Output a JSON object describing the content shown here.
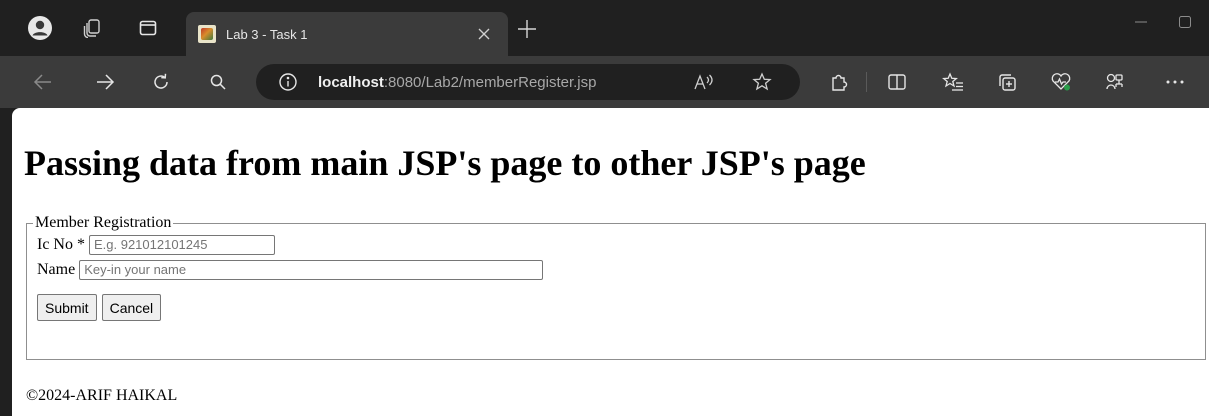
{
  "browser": {
    "tab": {
      "title": "Lab 3 - Task 1"
    },
    "address_bar": {
      "host": "localhost",
      "rest": ":8080/Lab2/memberRegister.jsp"
    }
  },
  "page": {
    "heading": "Passing data from main JSP's page to other JSP's page",
    "form": {
      "legend": "Member Registration",
      "ic_label": "Ic No * ",
      "ic_placeholder": "E.g. 921012101245",
      "name_label": "Name ",
      "name_placeholder": "Key-in your name",
      "submit_label": "Submit",
      "cancel_label": "Cancel"
    },
    "footer": "©2024-ARIF HAIKAL"
  },
  "icons": [
    "profile-icon",
    "workspaces-icon",
    "tab-actions-icon",
    "tab-favicon",
    "close-icon",
    "new-tab-icon",
    "minimize-icon",
    "maximize-icon",
    "back-icon",
    "forward-icon",
    "refresh-icon",
    "search-icon",
    "site-info-icon",
    "read-aloud-icon",
    "favorite-icon",
    "extensions-icon",
    "split-screen-icon",
    "favorites-icon",
    "collections-icon",
    "browser-essentials-icon",
    "copilot-icon",
    "more-icon"
  ]
}
